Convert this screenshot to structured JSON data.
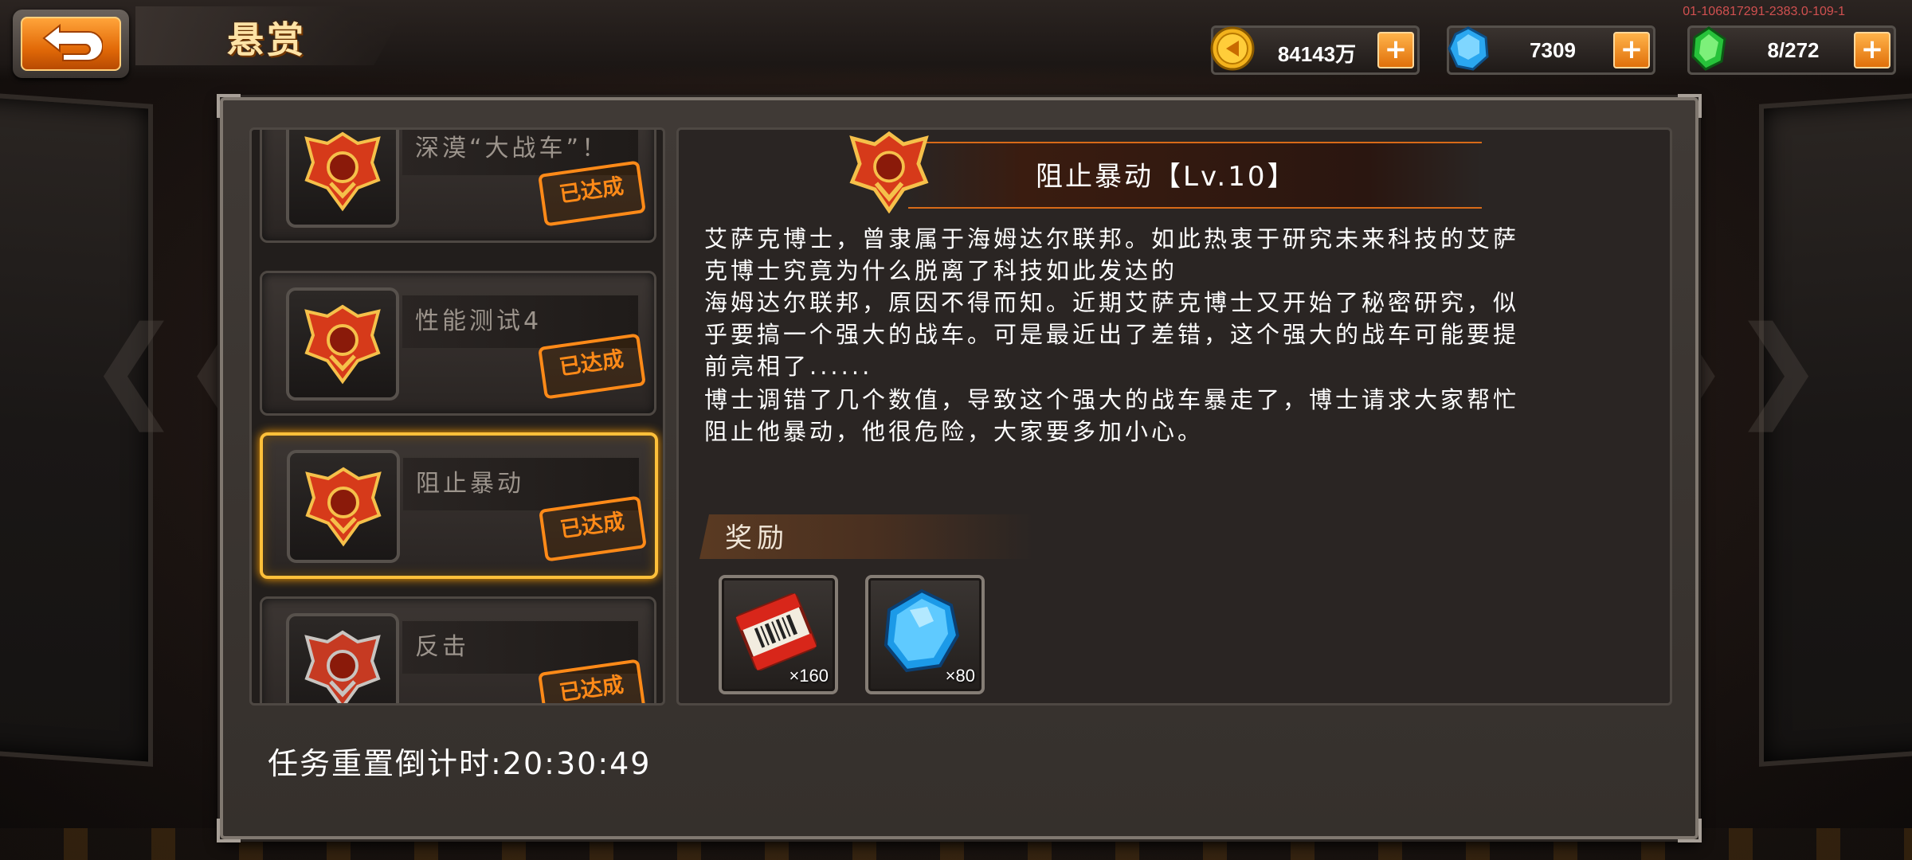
{
  "header": {
    "title": "悬赏",
    "version": "01-106817291-2383.0-109-1"
  },
  "currencies": [
    {
      "name": "gold",
      "value": "84143万",
      "icon": "gold-coin-icon"
    },
    {
      "name": "diamond",
      "value": "7309",
      "icon": "blue-gem-icon"
    },
    {
      "name": "energy",
      "value": "8/272",
      "icon": "green-crystal-icon"
    }
  ],
  "quests": [
    {
      "name": "深漠“大战车”！",
      "status": "已达成",
      "selected": false
    },
    {
      "name": "性能测试4",
      "status": "已达成",
      "selected": false
    },
    {
      "name": "阻止暴动",
      "status": "已达成",
      "selected": true
    },
    {
      "name": "反击",
      "status": "已达成",
      "selected": false
    }
  ],
  "detail": {
    "title": "阻止暴动【Lv.10】",
    "description_lines": [
      "艾萨克博士，曾隶属于海姆达尔联邦。如此热衷于研究未来科技的艾萨",
      "克博士究竟为什么脱离了科技如此发达的",
      "海姆达尔联邦，原因不得而知。近期艾萨克博士又开始了秘密研究，似",
      "乎要搞一个强大的战车。可是最近出了差错，这个强大的战车可能要提",
      "前亮相了......",
      "博士调错了几个数值，导致这个强大的战车暴走了，博士请求大家帮忙",
      "阻止他暴动，他很危险，大家要多加小心。"
    ],
    "reward_label": "奖励",
    "rewards": [
      {
        "icon": "ticket-icon",
        "qty": "×160"
      },
      {
        "icon": "blue-gem-icon",
        "qty": "×80"
      }
    ]
  },
  "footer": {
    "countdown": "任务重置倒计时:20:30:49"
  },
  "colors": {
    "accent": "#ff8a18",
    "selected_border": "#ffc03a"
  }
}
